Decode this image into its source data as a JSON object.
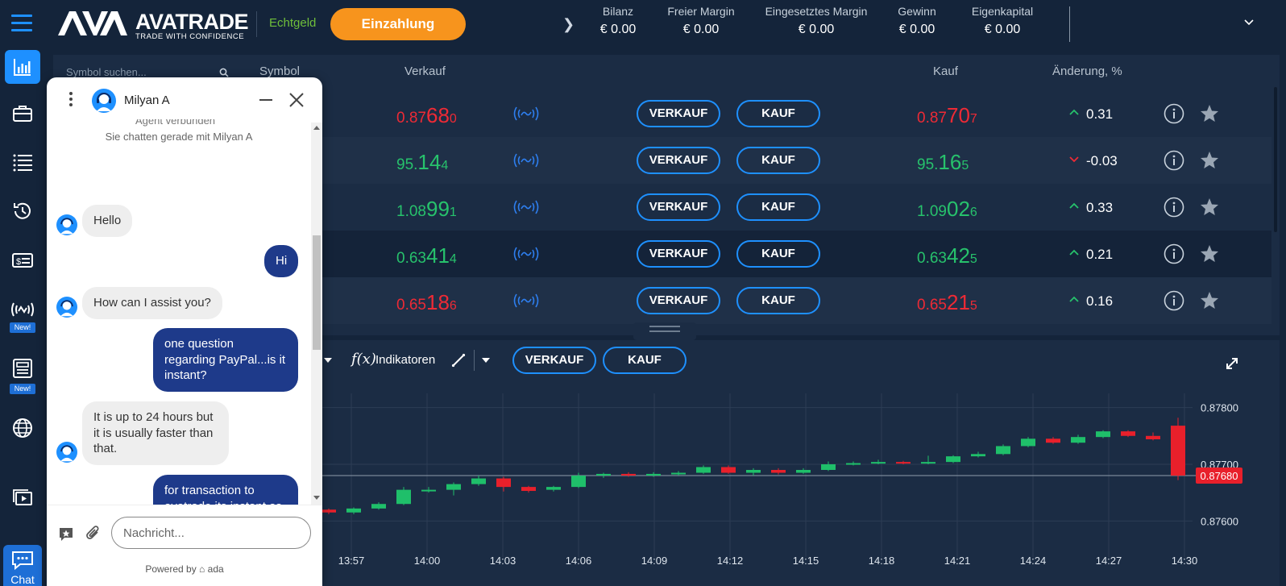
{
  "header": {
    "brand": "AVATRADE",
    "tagline": "TRADE WITH CONFIDENCE",
    "account_type": "Echtgeld",
    "deposit_label": "Einzahlung",
    "stats": [
      {
        "label": "Bilanz",
        "value": "€ 0.00"
      },
      {
        "label": "Freier Margin",
        "value": "€ 0.00"
      },
      {
        "label": "Eingesetztes Margin",
        "value": "€ 0.00"
      },
      {
        "label": "Gewinn",
        "value": "€ 0.00"
      },
      {
        "label": "Eigenkapital",
        "value": "€ 0.00"
      }
    ]
  },
  "sidebar": {
    "new_badge": "New!",
    "chat_label": "Chat"
  },
  "symbol_panel": {
    "search_placeholder": "Symbol suchen..."
  },
  "table": {
    "headers": {
      "symbol": "Symbol",
      "sell": "Verkauf",
      "buy": "Kauf",
      "change": "Änderung, %"
    },
    "sell_button": "VERKAUF",
    "buy_button": "KAUF",
    "rows": [
      {
        "sell": {
          "a": "0.87",
          "b": "68",
          "c": "0"
        },
        "buy": {
          "a": "0.87",
          "b": "70",
          "c": "7"
        },
        "color": "#ee2a35",
        "direction": "up",
        "change": "0.31"
      },
      {
        "sell": {
          "a": "95.",
          "b": "14",
          "c": "4"
        },
        "buy": {
          "a": "95.",
          "b": "16",
          "c": "5"
        },
        "color": "#27c26c",
        "direction": "down",
        "change": "-0.03"
      },
      {
        "sell": {
          "a": "1.08",
          "b": "99",
          "c": "1"
        },
        "buy": {
          "a": "1.09",
          "b": "02",
          "c": "6"
        },
        "color": "#27c26c",
        "direction": "up",
        "change": "0.33"
      },
      {
        "sell": {
          "a": "0.63",
          "b": "41",
          "c": "4"
        },
        "buy": {
          "a": "0.63",
          "b": "42",
          "c": "5"
        },
        "color": "#27c26c",
        "direction": "up",
        "change": "0.21"
      },
      {
        "sell": {
          "a": "0.65",
          "b": "18",
          "c": "6"
        },
        "buy": {
          "a": "0.65",
          "b": "21",
          "c": "5"
        },
        "color": "#ee2a35",
        "direction": "up",
        "change": "0.16"
      }
    ]
  },
  "chart_toolbar": {
    "indicators_label": "Indikatoren",
    "fx_label": "f(x)",
    "sell_button": "VERKAUF",
    "buy_button": "KAUF"
  },
  "chart_data": {
    "type": "candlestick",
    "y_ticks": [
      "0.87800",
      "0.87700",
      "0.87600"
    ],
    "ylim": [
      0.87555,
      0.87825
    ],
    "x_ticks": [
      "13:57",
      "14:00",
      "14:03",
      "14:06",
      "14:09",
      "14:12",
      "14:15",
      "14:18",
      "14:21",
      "14:24",
      "14:27",
      "14:30"
    ],
    "current_price": "0.87680",
    "current_value": 0.8768,
    "candles": [
      {
        "o": 0.8762,
        "c": 0.87615,
        "h": 0.87622,
        "l": 0.87612
      },
      {
        "o": 0.87615,
        "c": 0.87622,
        "h": 0.87624,
        "l": 0.87612
      },
      {
        "o": 0.87622,
        "c": 0.8763,
        "h": 0.87633,
        "l": 0.8762
      },
      {
        "o": 0.8763,
        "c": 0.87655,
        "h": 0.8766,
        "l": 0.87628
      },
      {
        "o": 0.87655,
        "c": 0.87655,
        "h": 0.8766,
        "l": 0.8765
      },
      {
        "o": 0.87655,
        "c": 0.87665,
        "h": 0.87668,
        "l": 0.87645
      },
      {
        "o": 0.87665,
        "c": 0.87675,
        "h": 0.8768,
        "l": 0.87662
      },
      {
        "o": 0.87675,
        "c": 0.8766,
        "h": 0.87678,
        "l": 0.87652
      },
      {
        "o": 0.8766,
        "c": 0.87653,
        "h": 0.87662,
        "l": 0.8765
      },
      {
        "o": 0.87655,
        "c": 0.8766,
        "h": 0.87662,
        "l": 0.87652
      },
      {
        "o": 0.8766,
        "c": 0.8768,
        "h": 0.87685,
        "l": 0.87658
      },
      {
        "o": 0.8768,
        "c": 0.87683,
        "h": 0.87685,
        "l": 0.87676
      },
      {
        "o": 0.87683,
        "c": 0.8768,
        "h": 0.87686,
        "l": 0.87678
      },
      {
        "o": 0.8768,
        "c": 0.87683,
        "h": 0.87686,
        "l": 0.87678
      },
      {
        "o": 0.87683,
        "c": 0.87685,
        "h": 0.87688,
        "l": 0.8768
      },
      {
        "o": 0.87685,
        "c": 0.87695,
        "h": 0.87698,
        "l": 0.87683
      },
      {
        "o": 0.87695,
        "c": 0.87685,
        "h": 0.87698,
        "l": 0.87683
      },
      {
        "o": 0.87685,
        "c": 0.8769,
        "h": 0.87693,
        "l": 0.8768
      },
      {
        "o": 0.8769,
        "c": 0.87685,
        "h": 0.87693,
        "l": 0.87682
      },
      {
        "o": 0.87685,
        "c": 0.8769,
        "h": 0.87693,
        "l": 0.87683
      },
      {
        "o": 0.8769,
        "c": 0.877,
        "h": 0.87705,
        "l": 0.87688
      },
      {
        "o": 0.877,
        "c": 0.87702,
        "h": 0.87705,
        "l": 0.87698
      },
      {
        "o": 0.87702,
        "c": 0.87704,
        "h": 0.87708,
        "l": 0.877
      },
      {
        "o": 0.87704,
        "c": 0.87702,
        "h": 0.87706,
        "l": 0.877
      },
      {
        "o": 0.87702,
        "c": 0.87704,
        "h": 0.87715,
        "l": 0.877
      },
      {
        "o": 0.87704,
        "c": 0.87714,
        "h": 0.87716,
        "l": 0.87702
      },
      {
        "o": 0.87714,
        "c": 0.87718,
        "h": 0.87722,
        "l": 0.87712
      },
      {
        "o": 0.87718,
        "c": 0.87732,
        "h": 0.87735,
        "l": 0.87716
      },
      {
        "o": 0.87732,
        "c": 0.87745,
        "h": 0.87748,
        "l": 0.8773
      },
      {
        "o": 0.87745,
        "c": 0.87738,
        "h": 0.87748,
        "l": 0.87736
      },
      {
        "o": 0.87738,
        "c": 0.87748,
        "h": 0.87752,
        "l": 0.87736
      },
      {
        "o": 0.87748,
        "c": 0.87758,
        "h": 0.8776,
        "l": 0.87746
      },
      {
        "o": 0.87758,
        "c": 0.8775,
        "h": 0.8776,
        "l": 0.87748
      },
      {
        "o": 0.8775,
        "c": 0.87744,
        "h": 0.87756,
        "l": 0.87742
      },
      {
        "o": 0.87768,
        "c": 0.8768,
        "h": 0.87782,
        "l": 0.87672
      }
    ],
    "up_color": "#1fbf6a",
    "down_color": "#e8202b",
    "grid": true
  },
  "chat": {
    "agent_name": "Milyan A",
    "system_cut": "Agent verbunden",
    "system_message": "Sie chatten gerade mit Milyan A",
    "messages": [
      {
        "from": "agent",
        "text": "Hello"
      },
      {
        "from": "user",
        "text": "Hi"
      },
      {
        "from": "agent",
        "text": "How can I assist you?"
      },
      {
        "from": "user",
        "text": "one question regarding PayPal...is it instant?"
      },
      {
        "from": "agent",
        "text": "It is up to 24 hours but it is usually faster than that."
      },
      {
        "from": "user",
        "text": "for transaction to avatrade its instant as well as withdrawals?"
      }
    ],
    "input_placeholder": "Nachricht...",
    "powered_by": "Powered by",
    "powered_brand": "ada"
  },
  "colors": {
    "accent": "#1e90ff",
    "deposit": "#f7941d",
    "sell_red": "#ee2a35",
    "buy_green": "#27c26c",
    "user_bubble": "#1e3a8a"
  }
}
